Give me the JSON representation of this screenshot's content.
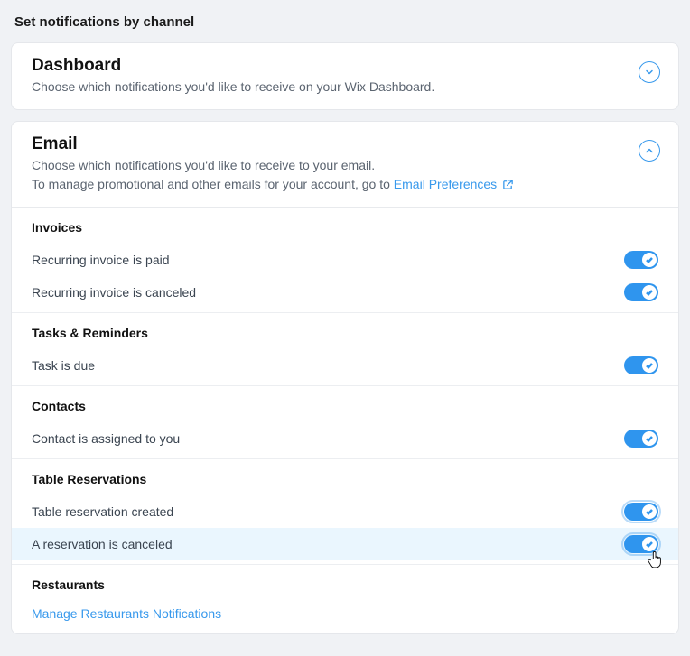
{
  "pageTitle": "Set notifications by channel",
  "dashboard": {
    "title": "Dashboard",
    "desc": "Choose which notifications you'd like to receive on your Wix Dashboard."
  },
  "email": {
    "title": "Email",
    "desc1": "Choose which notifications you'd like to receive to your email.",
    "desc2_prefix": "To manage promotional and other emails for your account, go to ",
    "desc2_link": "Email Preferences"
  },
  "sections": {
    "invoices": {
      "title": "Invoices",
      "items": [
        {
          "label": "Recurring invoice is paid",
          "on": true
        },
        {
          "label": "Recurring invoice is canceled",
          "on": true
        }
      ]
    },
    "tasks": {
      "title": "Tasks & Reminders",
      "items": [
        {
          "label": "Task is due",
          "on": true
        }
      ]
    },
    "contacts": {
      "title": "Contacts",
      "items": [
        {
          "label": "Contact is assigned to you",
          "on": true
        }
      ]
    },
    "tableReservations": {
      "title": "Table Reservations",
      "items": [
        {
          "label": "Table reservation created",
          "on": true
        },
        {
          "label": "A reservation is canceled",
          "on": true
        }
      ]
    },
    "restaurants": {
      "title": "Restaurants",
      "manageLink": "Manage Restaurants Notifications"
    }
  }
}
